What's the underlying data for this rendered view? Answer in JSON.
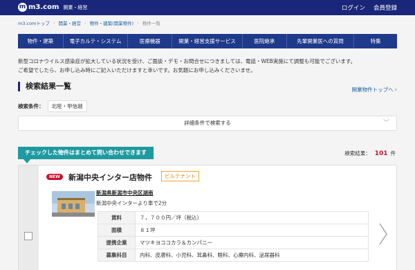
{
  "header": {
    "logo_mark": "m",
    "logo_text": "m3.com",
    "logo_sub": "開業・経営",
    "login": "ログイン",
    "register": "会員登録"
  },
  "breadcrumb": [
    "m3.comトップ",
    "開業・経営",
    "物件・建築(開業物件)",
    "物件一覧"
  ],
  "nav": [
    "物件・建築",
    "電子カルテ・システム",
    "医療機器",
    "開業・経営支援サービス",
    "医院継承",
    "先輩開業医への質問",
    "特集"
  ],
  "notice": [
    "新型コロナウイルス感染症が拡大している状況を受け、ご面談・デモ・お問合せにつきましては、電話・WEB実施にて調整も可能でございます。",
    "ご希望でしたら、お申し込み時にご記入いただけますと幸いです。お気軽にお申し込みくださいませ。"
  ],
  "results": {
    "heading": "検索結果一覧",
    "top_link": "開業物件トップへ ›",
    "conditions_label": "検索条件：",
    "conditions_value": "北陸・甲信越",
    "detail_search": "詳細条件で検索する",
    "inquiry_bar": "チェックした物件はまとめて問い合わせできます",
    "count_label": "検索結果：",
    "count": "101",
    "count_unit": "件"
  },
  "property": {
    "badge_new": "NEW",
    "title": "新潟中央インター店物件",
    "tenant_badge": "ビルテナント",
    "address": "新潟県新潟市中央区湖南",
    "access": "新潟中央インターより車で2分",
    "rows": [
      {
        "label": "賃料",
        "value": "７，７００円／坪（税込）"
      },
      {
        "label": "面積",
        "value": "８１坪"
      },
      {
        "label": "提携企業",
        "value": "マツキヨココカラ＆カンパニー"
      },
      {
        "label": "募集科目",
        "value": "内科、皮膚科、小児科、耳鼻科、眼科、心療内科、泌尿器科"
      }
    ]
  },
  "colors": {
    "header_bg": "#1a2679",
    "nav_bg": "#1f3a8a",
    "accent_teal": "#1e9aa0",
    "count_red": "#c8102e",
    "tenant_orange": "#e8a735"
  }
}
